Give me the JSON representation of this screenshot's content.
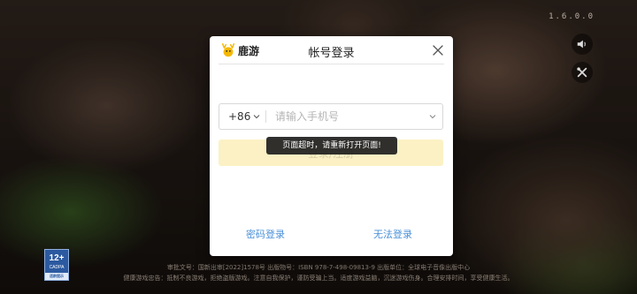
{
  "version": "1.6.0.0",
  "dialog": {
    "logo_text": "鹿游",
    "title": "帐号登录",
    "country_code": "+86",
    "phone_placeholder": "请输入手机号",
    "login_button": "登录/注册",
    "toast": "页面超时，请重新打开页面!",
    "password_login": "密码登录",
    "cannot_login": "无法登录"
  },
  "age_badge": {
    "rating": "12+",
    "label": "CADPA",
    "note": "适龄提示"
  },
  "footer": {
    "line1": "审批文号：国新出审[2022]1578号  出版物号：ISBN 978-7-498-09813-9  出版单位：全球电子音像出版中心",
    "line2": "健康游戏忠告：抵制不良游戏，拒绝盗版游戏。注意自我保护，谨防受骗上当。适度游戏益脑，沉迷游戏伤身。合理安排时间，享受健康生活。"
  },
  "colors": {
    "accent_blue": "#4a90d9",
    "login_button_bg": "#fbf1c4"
  },
  "icons": {
    "sound": "speaker-icon",
    "tools": "tools-icon",
    "close": "close-icon"
  }
}
